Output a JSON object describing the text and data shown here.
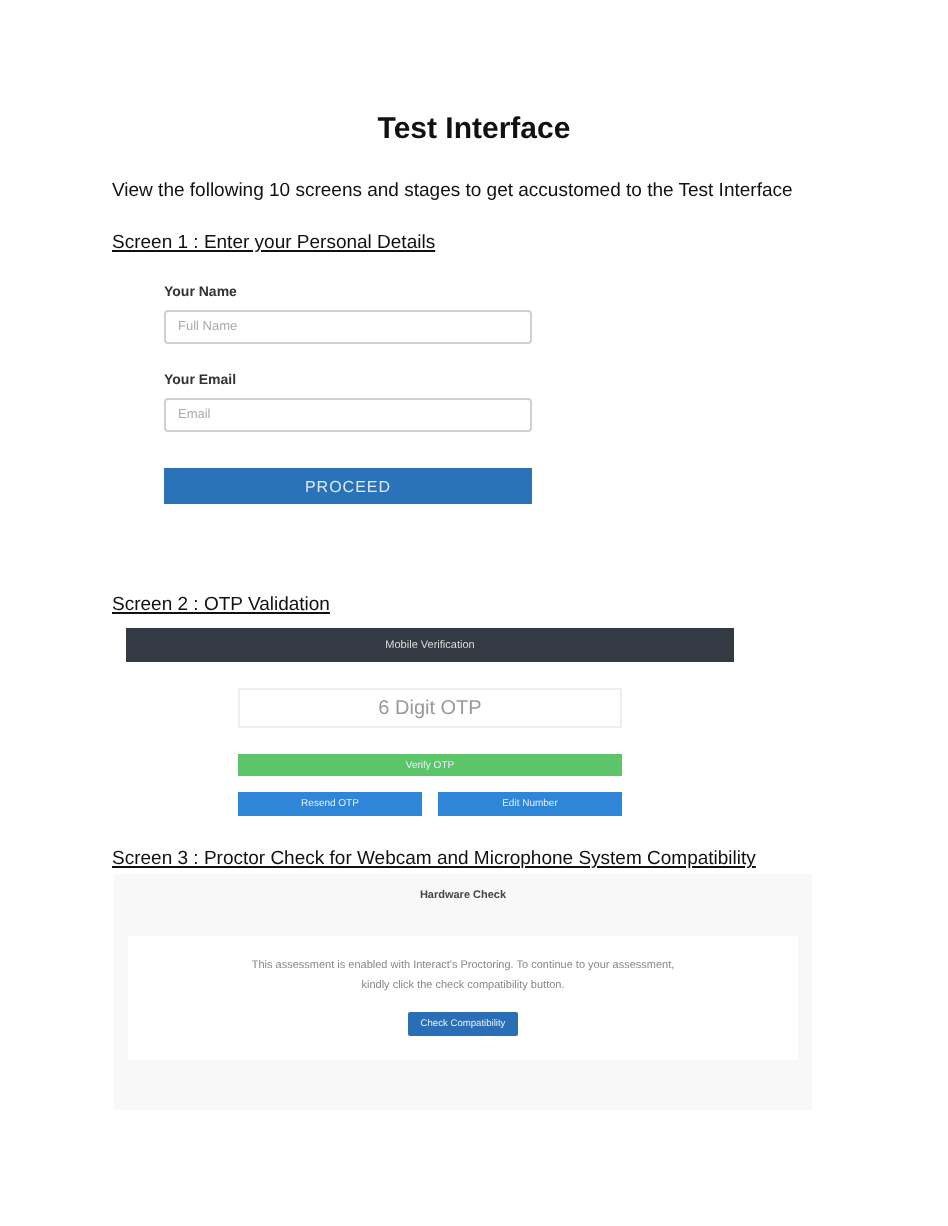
{
  "title": "Test Interface",
  "intro": "View the following 10 screens and stages to get accustomed to the Test Interface",
  "screen1": {
    "heading": "Screen 1 : Enter your Personal Details",
    "fields": [
      {
        "label": "Your Name",
        "placeholder": "Full Name"
      },
      {
        "label": "Your Email",
        "placeholder": "Email"
      }
    ],
    "button": "PROCEED"
  },
  "screen2": {
    "heading": "Screen 2 : OTP Validation",
    "bar_title": "Mobile Verification",
    "otp_placeholder": "6 Digit OTP",
    "verify_button": "Verify OTP",
    "buttons": [
      "Resend OTP",
      "Edit Number"
    ]
  },
  "screen3": {
    "heading": "Screen 3 : Proctor Check for Webcam and Microphone System Compatibility",
    "panel_title": "Hardware Check",
    "message": "This assessment is enabled with Interact's Proctoring. To continue to your assessment, kindly click the check compatibility button.",
    "button": "Check Compatibility"
  }
}
